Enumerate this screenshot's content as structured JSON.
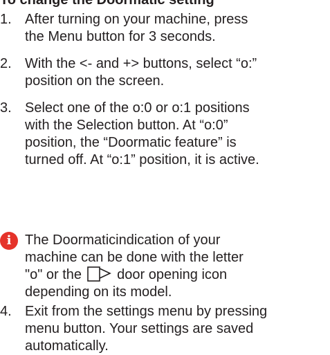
{
  "heading": "To change the Doormatic setting",
  "steps": [
    {
      "number": "1.",
      "lines": [
        "After turning on your machine, press",
        "the Menu button for 3 seconds."
      ]
    },
    {
      "number": "2.",
      "lines": [
        "With the <- and +> buttons, select “o:”",
        "position on the screen."
      ]
    },
    {
      "number": "3.",
      "lines": [
        "Select one of the o:0 or o:1 positions",
        "with the Selection button. At “o:0”",
        "position, the “Doormatic feature” is",
        "turned off. At “o:1” position, it is active."
      ]
    },
    {
      "number": "4.",
      "lines": [
        "Exit from the settings menu by pressing",
        "menu button. Your settings are saved",
        "automatically."
      ]
    }
  ],
  "note": {
    "icon": "info-icon",
    "icon_color": "#e5332a",
    "line1": "The Doormaticindication of your",
    "line2": "machine can be done with the letter",
    "line3_before": "\"o\" or the",
    "door_icon": "door-opening-icon",
    "line3_after": "door opening icon",
    "line4": "depending on its model."
  }
}
